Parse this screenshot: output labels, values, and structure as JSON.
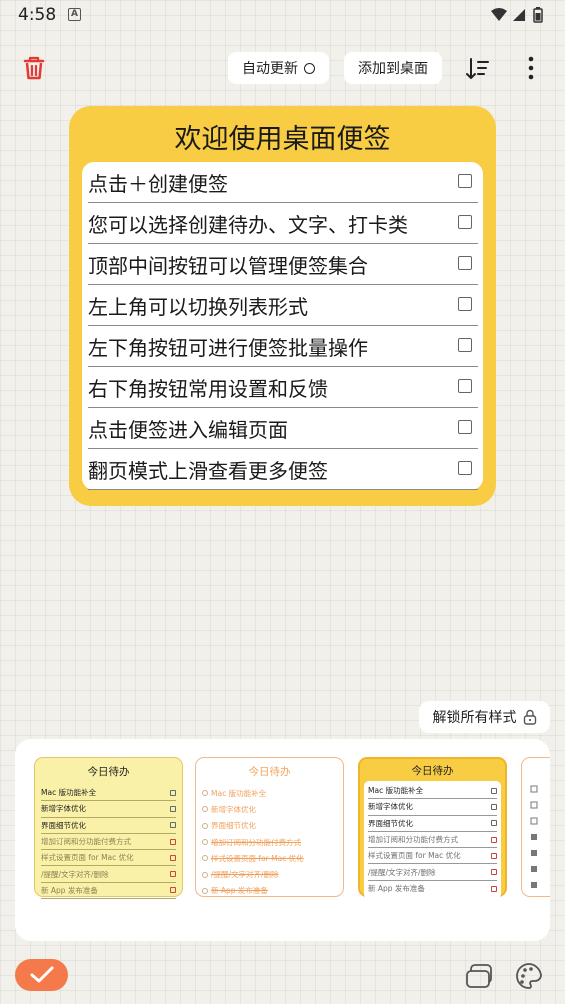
{
  "status_bar": {
    "time": "4:58",
    "notification_letter": "A"
  },
  "toolbar": {
    "auto_update_label": "自动更新",
    "add_to_desktop_label": "添加到桌面"
  },
  "note": {
    "title": "欢迎使用桌面便签",
    "items": [
      {
        "text": "点击＋创建便签",
        "checked": false
      },
      {
        "text": "您可以选择创建待办、文字、打卡类",
        "checked": false
      },
      {
        "text": "顶部中间按钮可以管理便签集合",
        "checked": false
      },
      {
        "text": "左上角可以切换列表形式",
        "checked": false
      },
      {
        "text": "左下角按钮可进行便签批量操作",
        "checked": false
      },
      {
        "text": "右下角按钮常用设置和反馈",
        "checked": false
      },
      {
        "text": "点击便签进入编辑页面",
        "checked": false
      },
      {
        "text": "翻页模式上滑查看更多便签",
        "checked": false
      }
    ]
  },
  "styles_panel": {
    "unlock_label": "解锁所有样式",
    "preview_title": "今日待办",
    "preview_items": [
      {
        "text": "Mac 版功能补全",
        "done": false
      },
      {
        "text": "新增字体优化",
        "done": false
      },
      {
        "text": "界面细节优化",
        "done": false
      },
      {
        "text": "增加订阅和分功能付费方式",
        "done": true
      },
      {
        "text": "样式设置页面 for Mac 优化",
        "done": true
      },
      {
        "text": "/提醒/文字对齐/删除",
        "done": true
      },
      {
        "text": "新 App 发布准备",
        "done": true
      }
    ]
  },
  "colors": {
    "accent": "#f8cd44",
    "fab": "#f47a4b",
    "trash": "#e53935",
    "background": "#f1f0ea"
  },
  "icons": [
    "trash-icon",
    "sort-icon",
    "more-vertical-icon",
    "lock-icon",
    "check-icon",
    "stack-icon",
    "palette-icon",
    "wifi-icon",
    "signal-icon",
    "battery-icon"
  ]
}
